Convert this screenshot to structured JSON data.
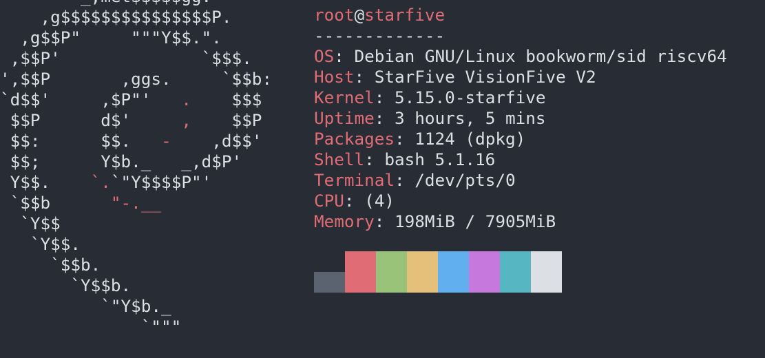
{
  "logo": {
    "lines": [
      {
        "parts": [
          {
            "t": "        _,met$$$$$gg.",
            "c": ""
          }
        ]
      },
      {
        "parts": [
          {
            "t": "    ,g$$$$$$$$$$$$$$$P.",
            "c": ""
          }
        ]
      },
      {
        "parts": [
          {
            "t": "  ,g$$P\"     \"\"\"Y$$.\".",
            "c": ""
          }
        ]
      },
      {
        "parts": [
          {
            "t": " ,$$P'              `$$$.",
            "c": ""
          }
        ]
      },
      {
        "parts": [
          {
            "t": "',$$P       ,ggs.     `$$b:",
            "c": ""
          }
        ]
      },
      {
        "parts": [
          {
            "t": "`d$$'     ,$P\"'   ",
            "c": ""
          },
          {
            "t": ".",
            "c": "red"
          },
          {
            "t": "    $$$",
            "c": ""
          }
        ]
      },
      {
        "parts": [
          {
            "t": " $$P      d$'     ",
            "c": ""
          },
          {
            "t": ",",
            "c": "red"
          },
          {
            "t": "    $$P",
            "c": ""
          }
        ]
      },
      {
        "parts": [
          {
            "t": " $$:      $$.   ",
            "c": ""
          },
          {
            "t": "-",
            "c": "red"
          },
          {
            "t": "    ,d$$'",
            "c": ""
          }
        ]
      },
      {
        "parts": [
          {
            "t": " $$;      Y$b._   _,d$P'",
            "c": ""
          }
        ]
      },
      {
        "parts": [
          {
            "t": " Y$$.    ",
            "c": ""
          },
          {
            "t": "`.",
            "c": "red"
          },
          {
            "t": "`\"Y$$$$P\"'",
            "c": ""
          }
        ]
      },
      {
        "parts": [
          {
            "t": " `$$b      ",
            "c": ""
          },
          {
            "t": "\"-.__",
            "c": "red"
          }
        ]
      },
      {
        "parts": [
          {
            "t": "  `Y$$",
            "c": ""
          }
        ]
      },
      {
        "parts": [
          {
            "t": "   `Y$$.",
            "c": ""
          }
        ]
      },
      {
        "parts": [
          {
            "t": "     `$$b.",
            "c": ""
          }
        ]
      },
      {
        "parts": [
          {
            "t": "       `Y$$b.",
            "c": ""
          }
        ]
      },
      {
        "parts": [
          {
            "t": "          `\"Y$b._",
            "c": ""
          }
        ]
      },
      {
        "parts": [
          {
            "t": "              `\"\"\"",
            "c": ""
          }
        ]
      }
    ]
  },
  "header": {
    "user": "root",
    "at": "@",
    "host": "starfive",
    "separator": "-------------"
  },
  "info": [
    {
      "key": "OS",
      "value": "Debian GNU/Linux bookworm/sid riscv64"
    },
    {
      "key": "Host",
      "value": "StarFive VisionFive V2"
    },
    {
      "key": "Kernel",
      "value": "5.15.0-starfive"
    },
    {
      "key": "Uptime",
      "value": "3 hours, 5 mins"
    },
    {
      "key": "Packages",
      "value": "1124 (dpkg)"
    },
    {
      "key": "Shell",
      "value": "bash 5.1.16"
    },
    {
      "key": "Terminal",
      "value": "/dev/pts/0"
    },
    {
      "key": "CPU",
      "value": "(4)"
    },
    {
      "key": "Memory",
      "value": "198MiB / 7905MiB"
    }
  ],
  "palette": {
    "colors": [
      "#5c6370",
      "#e06c75",
      "#98c379",
      "#e5c07b",
      "#61afef",
      "#c678dd",
      "#56b6c2",
      "#dcdfe4"
    ]
  }
}
